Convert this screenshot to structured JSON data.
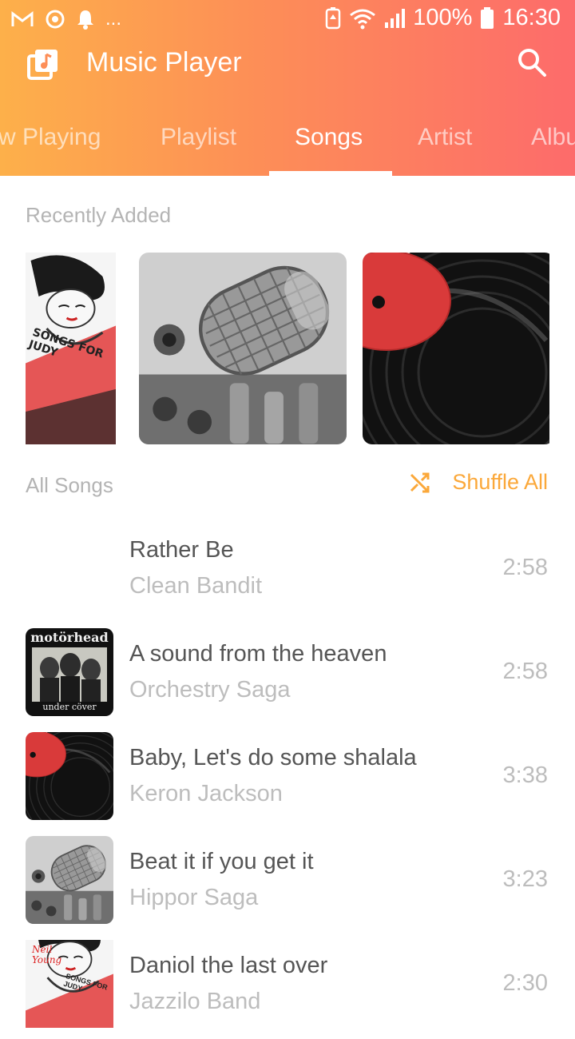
{
  "status_bar": {
    "left_icons": [
      "gmail-icon",
      "sync-icon",
      "notification-bell-icon",
      "more-dots"
    ],
    "more_text": "...",
    "battery_percent": "100%",
    "time": "16:30"
  },
  "app": {
    "title": "Music Player",
    "gradient": [
      "#fdb04a",
      "#fd6b6b"
    ]
  },
  "tabs": [
    {
      "label": "w Playing"
    },
    {
      "label": "Playlist"
    },
    {
      "label": "Songs",
      "active": true
    },
    {
      "label": "Artist"
    },
    {
      "label": "Albu"
    }
  ],
  "recently_added": {
    "label": "Recently Added",
    "items": [
      {
        "name": "songs-for-judy-cover",
        "art_text": "SONGS FOR JUDY"
      },
      {
        "name": "microphone-cover"
      },
      {
        "name": "vinyl-record-cover"
      }
    ]
  },
  "all_songs": {
    "label": "All Songs",
    "shuffle_label": "Shuffle All",
    "accent": "#fba83a"
  },
  "songs": [
    {
      "title": "Rather Be",
      "artist": "Clean Bandit",
      "duration": "2:58",
      "art": "none"
    },
    {
      "title": "A sound from the heaven",
      "artist": "Orchestry Saga",
      "duration": "2:58",
      "art": "motorhead",
      "art_text": [
        "motörhead",
        "under cöver"
      ]
    },
    {
      "title": "Baby, Let's do some shalala",
      "artist": "Keron Jackson",
      "duration": "3:38",
      "art": "vinyl"
    },
    {
      "title": "Beat it if you get it",
      "artist": "Hippor Saga",
      "duration": "3:23",
      "art": "microphone"
    },
    {
      "title": "Daniol the last over",
      "artist": "Jazzilo Band",
      "duration": "2:30",
      "art": "judy",
      "art_text": [
        "Neil Young",
        "SONGS FOR JUDY"
      ]
    }
  ]
}
